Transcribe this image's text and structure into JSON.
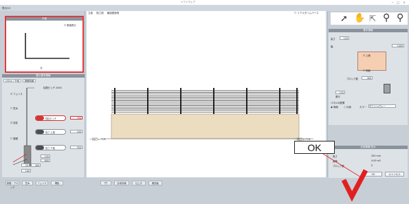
{
  "window": {
    "title": "ソフトウェア",
    "menu_label": "表示(V)"
  },
  "left_panel": {
    "plan_header": "平面",
    "plan_checkbox": "数値表示",
    "plan_point_label": "P",
    "props_header": "壁の基本情報",
    "tabs": [
      "パネル・下地",
      "基礎情報"
    ],
    "top_label": "柱間ピッチ 2000",
    "items": [
      {
        "label": "フェンス",
        "checked": true
      },
      {
        "label": "笠木",
        "checked": false
      },
      {
        "label": "控柱",
        "checked": true
      },
      {
        "label": "基礎",
        "checked": false
      }
    ],
    "pills": [
      {
        "text": "控柱ピッチ",
        "value": "750",
        "highlighted": true
      },
      {
        "text": "長さ 上端",
        "value": "100",
        "highlighted": false
      },
      {
        "text": "長さ 下端",
        "value": "350",
        "highlighted": false
      }
    ],
    "small_values": [
      "150",
      "600",
      "20",
      "400",
      "100"
    ]
  },
  "canvas": {
    "tabs": [
      "立面",
      "施工図",
      "軸組図面他"
    ],
    "realtime_label": "リアルタイムパース",
    "left_label": "一段目レベル",
    "right_label": "一段目レベル"
  },
  "right_panel": {
    "toolbar_icons": [
      "cursor-icon",
      "hand-icon",
      "pointer-icon",
      "pin-icon",
      "pin-alt-icon"
    ],
    "basic_header": "基本情報",
    "fields": [
      {
        "label": "高さ",
        "value": "120"
      },
      {
        "label": "幅",
        "value": "1000"
      },
      {
        "label": "ブロック数",
        "value": "400"
      },
      {
        "label": "奥行",
        "value": "150"
      }
    ],
    "checks": [
      "上面",
      "側面"
    ],
    "radio_label": "パネルの配置",
    "radio_options": [
      "両面",
      "片面"
    ],
    "color_label": "カラー",
    "color_value": "ホワイト/グレー",
    "sel_header": "目地情報/笠木",
    "sel_rows": [
      {
        "label": "長さ",
        "value": "200 mm"
      },
      {
        "label": "面積",
        "value": "0.00 m2"
      },
      {
        "label": "ブロック数",
        "value": "0"
      }
    ],
    "ok_label": "OK",
    "cancel_label": "キャンセル"
  },
  "bottom_bar": {
    "buttons": [
      "基礎・ブロック",
      "笠木",
      "フェンス",
      "柵板",
      "門",
      "目地情報",
      "仕上げ",
      "確認画"
    ]
  },
  "annotation": {
    "callout": "OK",
    "accent": "#e02020"
  }
}
